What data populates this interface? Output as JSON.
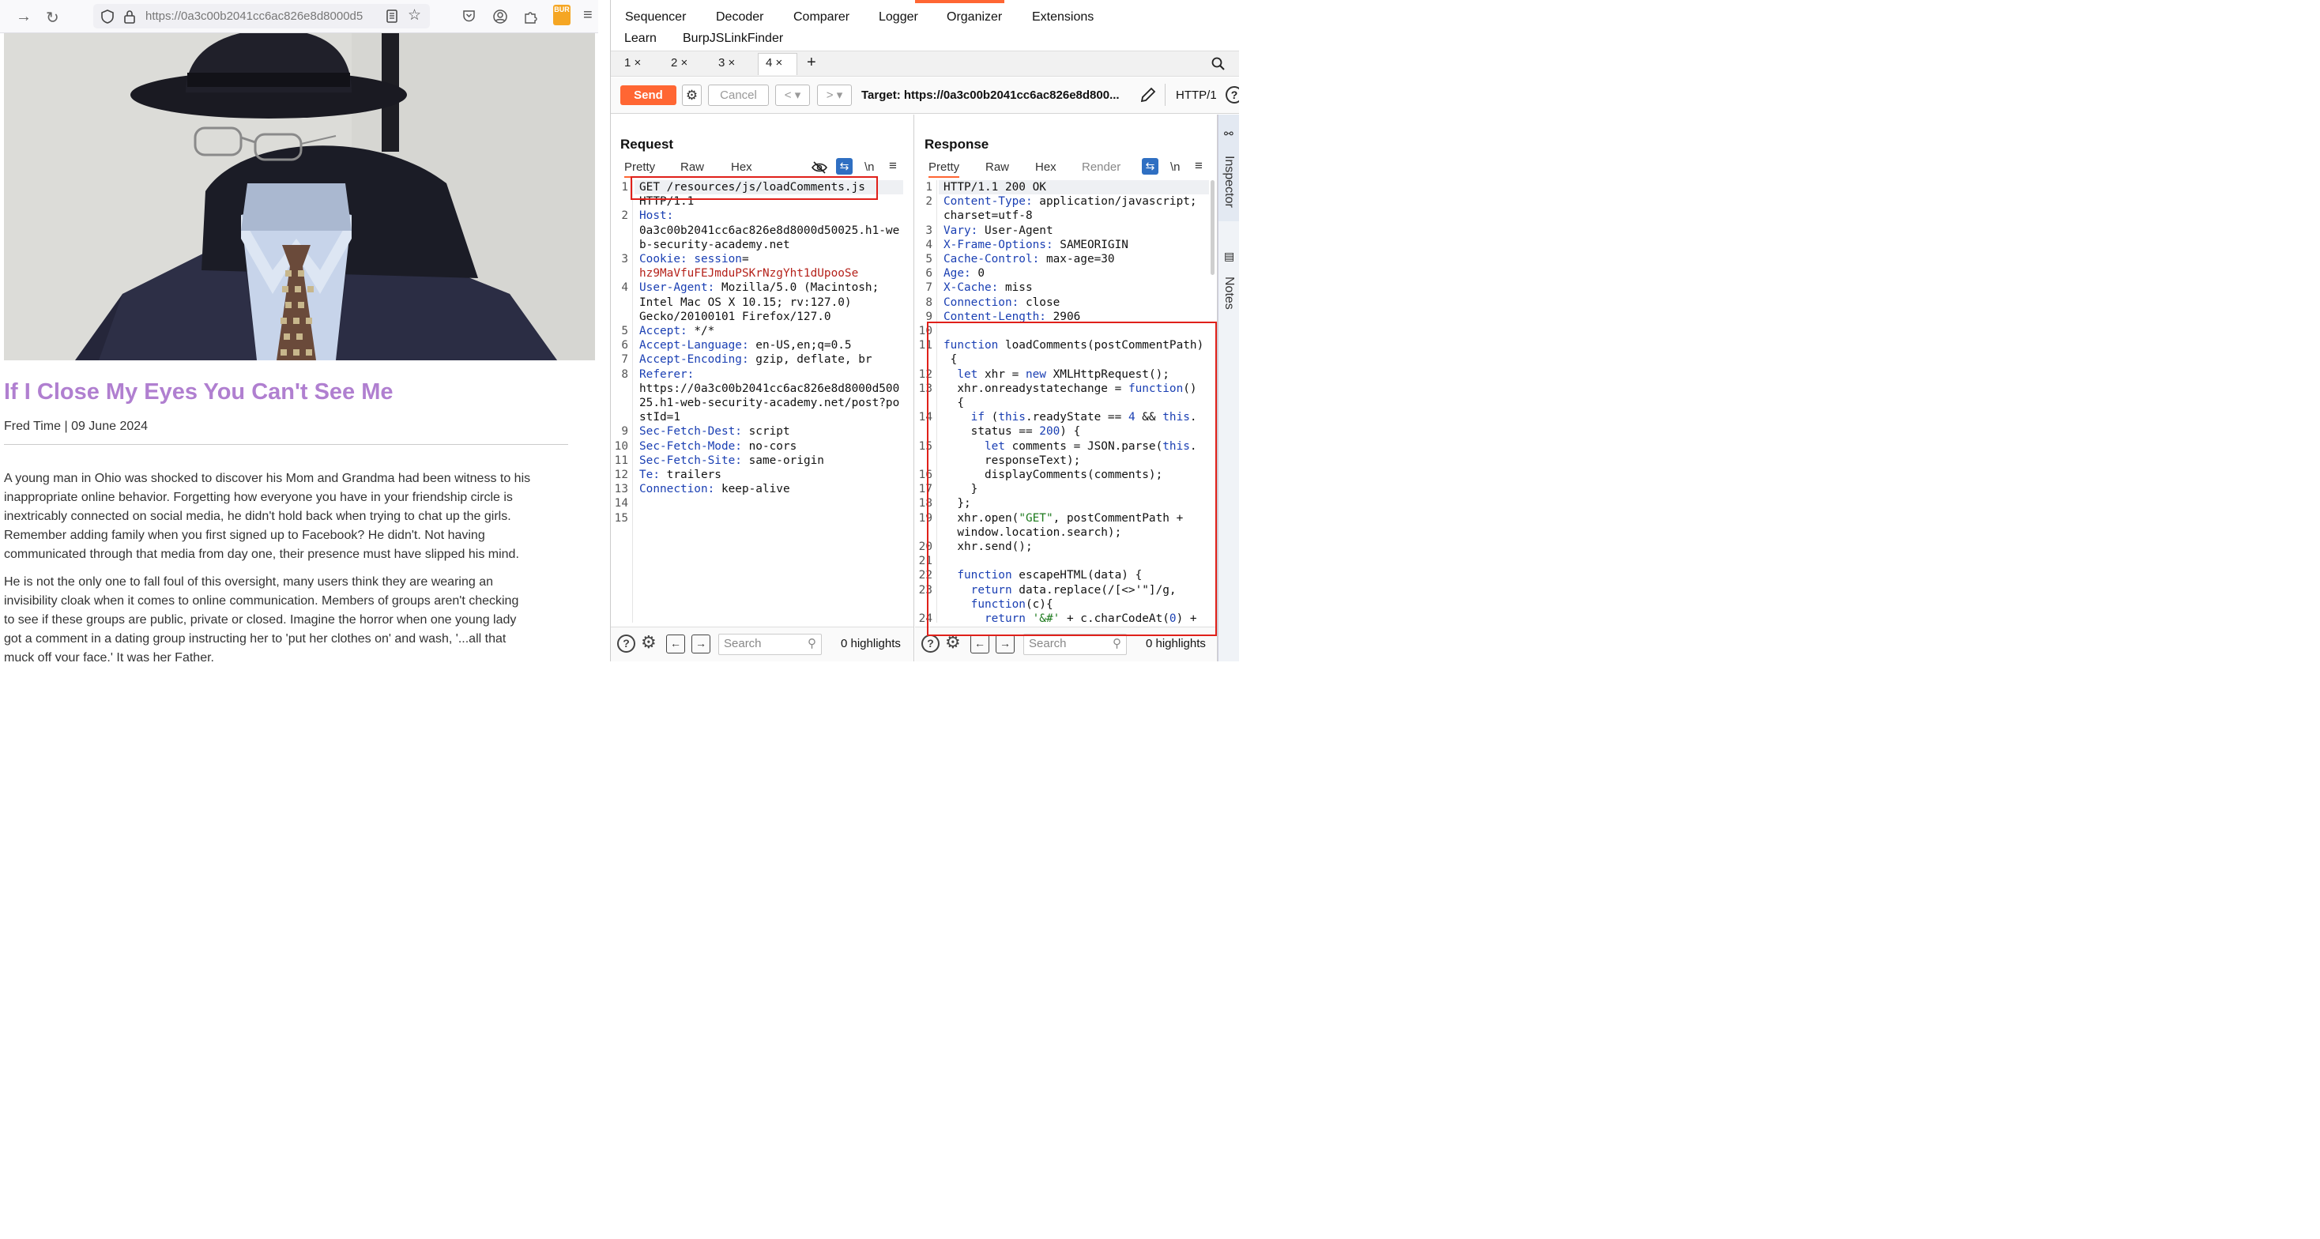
{
  "browser": {
    "url": "https://0a3c00b2041cc6ac826e8d8000d5",
    "ext_label": "BUR"
  },
  "post": {
    "title": "If I Close My Eyes You Can't See Me",
    "meta": "Fred Time | 09 June 2024",
    "paragraphs": [
      [
        "A young man in Ohio was shocked to discover his Mom and Grandma had been witness to his",
        "inappropriate online behavior. Forgetting how everyone you have in your friendship circle is",
        "inextricably connected on social media, he didn't hold back when trying to chat up the girls.",
        "Remember adding family when you first signed up to Facebook? He didn't. Not having",
        "communicated through that media from day one, their presence must have slipped his mind."
      ],
      [
        "He is not the only one to fall foul of this oversight, many users think they are wearing an",
        "invisibility cloak when it comes to online communication. Members of groups aren't checking",
        "to see if these groups are public, private or closed. Imagine the horror when one young lady",
        "got a comment in a dating group instructing her to 'put her clothes on' and wash, '...all that",
        "muck off your face.' It was her Father."
      ]
    ]
  },
  "burp": {
    "menu_row1": [
      "Sequencer",
      "Decoder",
      "Comparer",
      "Logger",
      "Organizer",
      "Extensions"
    ],
    "menu_row2": [
      "Learn",
      "BurpJSLinkFinder"
    ],
    "tabs": [
      "1 ×",
      "2 ×",
      "3 ×",
      "4 ×"
    ],
    "add_tab": "+",
    "send": "Send",
    "cancel": "Cancel",
    "target": "Target: https://0a3c00b2041cc6ac826e8d800...",
    "http_version": "HTTP/1",
    "request": {
      "title": "Request",
      "tabs": [
        "Pretty",
        "Raw",
        "Hex"
      ],
      "newline_toggle": "\\n",
      "line_numbers": [
        "1",
        "",
        "2",
        "",
        "",
        "3",
        "",
        "4",
        "",
        "",
        "5",
        "6",
        "7",
        "8",
        "",
        "",
        "",
        "9",
        "10",
        "11",
        "12",
        "13",
        "14",
        "15"
      ],
      "lines": [
        [
          [
            "GET /resources/js/loadComments.js",
            ""
          ]
        ],
        [
          [
            "HTTP/1.1",
            ""
          ]
        ],
        [
          [
            "Host:",
            "k"
          ]
        ],
        [
          [
            "0a3c00b2041cc6ac826e8d8000d50025.h1-we",
            ""
          ]
        ],
        [
          [
            "b-security-academy.net",
            ""
          ]
        ],
        [
          [
            "Cookie: ",
            "k"
          ],
          [
            "session",
            "k"
          ],
          [
            "=",
            ""
          ]
        ],
        [
          [
            "hz9MaVfuFEJmduPSKrNzgYht1dUpooSe",
            "v"
          ]
        ],
        [
          [
            "User-Agent:",
            "k"
          ],
          [
            " Mozilla/5.0 (Macintosh;",
            ""
          ]
        ],
        [
          [
            "Intel Mac OS X 10.15; rv:127.0)",
            ""
          ]
        ],
        [
          [
            "Gecko/20100101 Firefox/127.0",
            ""
          ]
        ],
        [
          [
            "Accept:",
            "k"
          ],
          [
            " */*",
            ""
          ]
        ],
        [
          [
            "Accept-Language:",
            "k"
          ],
          [
            " en-US,en;q=0.5",
            ""
          ]
        ],
        [
          [
            "Accept-Encoding:",
            "k"
          ],
          [
            " gzip, deflate, br",
            ""
          ]
        ],
        [
          [
            "Referer:",
            "k"
          ]
        ],
        [
          [
            "https://0a3c00b2041cc6ac826e8d8000d500",
            ""
          ]
        ],
        [
          [
            "25.h1-web-security-academy.net/post?po",
            ""
          ]
        ],
        [
          [
            "stId=1",
            ""
          ]
        ],
        [
          [
            "Sec-Fetch-Dest:",
            "k"
          ],
          [
            " script",
            ""
          ]
        ],
        [
          [
            "Sec-Fetch-Mode:",
            "k"
          ],
          [
            " no-cors",
            ""
          ]
        ],
        [
          [
            "Sec-Fetch-Site:",
            "k"
          ],
          [
            " same-origin",
            ""
          ]
        ],
        [
          [
            "Te:",
            "k"
          ],
          [
            " trailers",
            ""
          ]
        ],
        [
          [
            "Connection:",
            "k"
          ],
          [
            " keep-alive",
            ""
          ]
        ],
        [
          [
            "",
            ""
          ]
        ],
        [
          [
            "",
            ""
          ]
        ]
      ],
      "search_placeholder": "Search",
      "highlights": "0 highlights"
    },
    "response": {
      "title": "Response",
      "tabs": [
        "Pretty",
        "Raw",
        "Hex",
        "Render"
      ],
      "newline_toggle": "\\n",
      "line_numbers": [
        "1",
        "2",
        "",
        "3",
        "4",
        "5",
        "6",
        "7",
        "8",
        "9",
        "10",
        "11",
        "",
        "12",
        "13",
        "",
        "14",
        "",
        "15",
        "",
        "16",
        "17",
        "18",
        "19",
        "",
        "20",
        "21",
        "22",
        "23",
        "",
        "24"
      ],
      "lines": [
        [
          [
            "HTTP/1.1 200 OK",
            ""
          ]
        ],
        [
          [
            "Content-Type:",
            "k"
          ],
          [
            " application/javascript;",
            ""
          ]
        ],
        [
          [
            "charset=utf-8",
            ""
          ]
        ],
        [
          [
            "Vary:",
            "k"
          ],
          [
            " User-Agent",
            ""
          ]
        ],
        [
          [
            "X-Frame-Options:",
            "k"
          ],
          [
            " SAMEORIGIN",
            ""
          ]
        ],
        [
          [
            "Cache-Control:",
            "k"
          ],
          [
            " max-age=30",
            ""
          ]
        ],
        [
          [
            "Age:",
            "k"
          ],
          [
            " 0",
            ""
          ]
        ],
        [
          [
            "X-Cache:",
            "k"
          ],
          [
            " miss",
            ""
          ]
        ],
        [
          [
            "Connection:",
            "k"
          ],
          [
            " close",
            ""
          ]
        ],
        [
          [
            "Content-Length:",
            "k"
          ],
          [
            " 2906",
            ""
          ]
        ],
        [
          [
            "",
            ""
          ]
        ],
        [
          [
            "function",
            "k"
          ],
          [
            " loadComments(postCommentPath)",
            ""
          ]
        ],
        [
          [
            " {",
            ""
          ]
        ],
        [
          [
            "  ",
            ""
          ],
          [
            "let",
            "k"
          ],
          [
            " xhr = ",
            ""
          ],
          [
            "new",
            "k"
          ],
          [
            " XMLHttpRequest();",
            ""
          ]
        ],
        [
          [
            "  xhr.onreadystatechange = ",
            ""
          ],
          [
            "function",
            "k"
          ],
          [
            "()",
            ""
          ]
        ],
        [
          [
            "  {",
            ""
          ]
        ],
        [
          [
            "    ",
            ""
          ],
          [
            "if",
            "k"
          ],
          [
            " (",
            ""
          ],
          [
            "this",
            "k"
          ],
          [
            ".readyState == ",
            ""
          ],
          [
            "4",
            "n"
          ],
          [
            " && ",
            ""
          ],
          [
            "this",
            "k"
          ],
          [
            ".",
            ""
          ]
        ],
        [
          [
            "    status == ",
            ""
          ],
          [
            "200",
            "n"
          ],
          [
            ") {",
            ""
          ]
        ],
        [
          [
            "      ",
            ""
          ],
          [
            "let",
            "k"
          ],
          [
            " comments = JSON.parse(",
            ""
          ],
          [
            "this",
            "k"
          ],
          [
            ".",
            ""
          ]
        ],
        [
          [
            "      responseText);",
            ""
          ]
        ],
        [
          [
            "      displayComments(comments);",
            ""
          ]
        ],
        [
          [
            "    }",
            ""
          ]
        ],
        [
          [
            "  };",
            ""
          ]
        ],
        [
          [
            "  xhr.open(",
            ""
          ],
          [
            "\"GET\"",
            "s"
          ],
          [
            ", postCommentPath +",
            ""
          ]
        ],
        [
          [
            "  window.location.search);",
            ""
          ]
        ],
        [
          [
            "  xhr.send();",
            ""
          ]
        ],
        [
          [
            "",
            ""
          ]
        ],
        [
          [
            "  ",
            ""
          ],
          [
            "function",
            "k"
          ],
          [
            " escapeHTML(data) {",
            ""
          ]
        ],
        [
          [
            "    ",
            ""
          ],
          [
            "return",
            "k"
          ],
          [
            " data.replace(/[<>'\"]/g,",
            ""
          ]
        ],
        [
          [
            "    ",
            ""
          ],
          [
            "function",
            "k"
          ],
          [
            "(c){",
            ""
          ]
        ],
        [
          [
            "      ",
            ""
          ],
          [
            "return",
            "k"
          ],
          [
            " ",
            ""
          ],
          [
            "'&#'",
            "s"
          ],
          [
            " + c.charCodeAt(",
            ""
          ],
          [
            "0",
            "n"
          ],
          [
            ") +",
            ""
          ]
        ]
      ],
      "search_placeholder": "Search",
      "highlights": "0 highlights"
    },
    "sidebar": [
      "Inspector",
      "Notes"
    ]
  }
}
